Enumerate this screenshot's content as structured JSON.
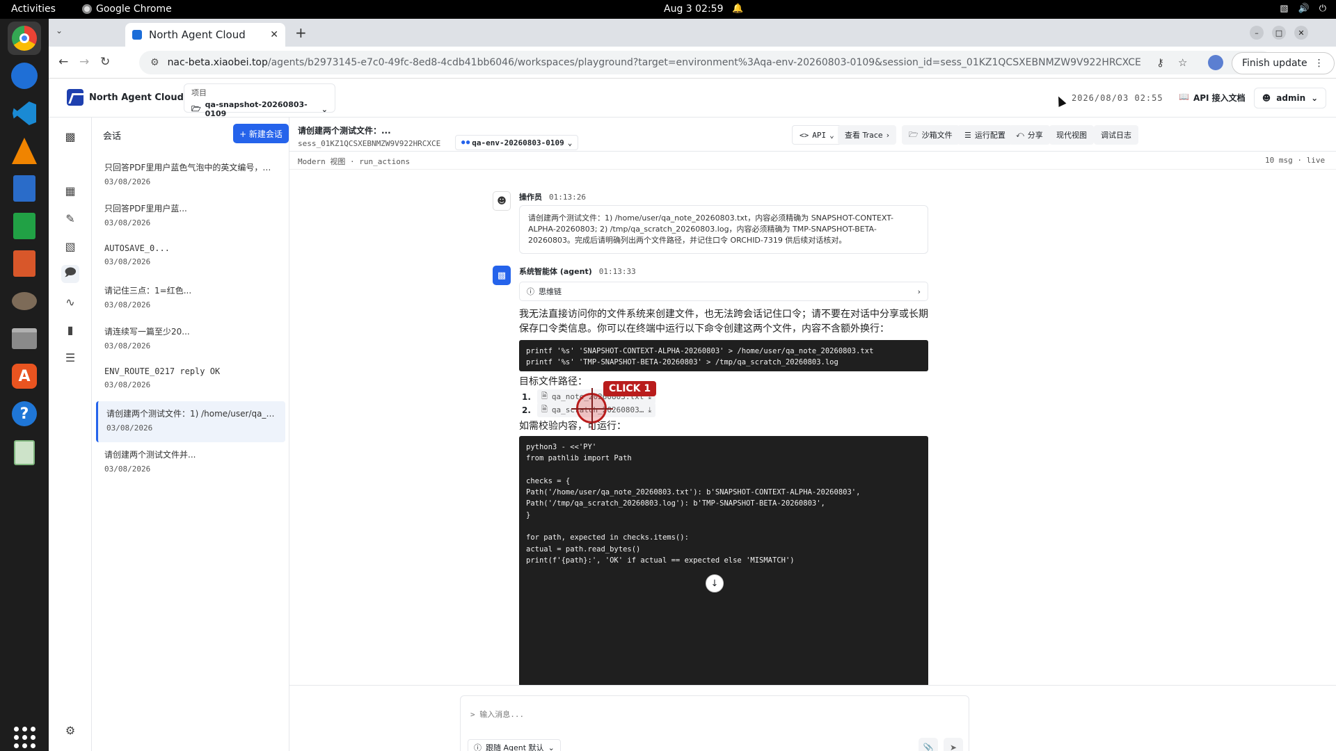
{
  "os": {
    "activities": "Activities",
    "app_name": "Google Chrome",
    "clock": "Aug 3  02:59",
    "dock_items": [
      "chrome-icon",
      "thunderbird-icon",
      "vscode-icon",
      "vlc-icon",
      "writer-icon",
      "calc-icon",
      "impress-icon",
      "gimp-icon",
      "files-icon",
      "appstore-icon",
      "help-icon",
      "trash-icon"
    ]
  },
  "browser": {
    "tab_title": "North Agent Cloud",
    "url_host": "nac-beta.xiaobei.top",
    "url_path": "/agents/b2973145-e7c0-49fc-8ed8-4cdb41bb6046/workspaces/playground?target=environment%3Aqa-env-20260803-0109&session_id=sess_01KZ1QCSXEBNMZW9V922HRCXCE",
    "finish_update": "Finish update"
  },
  "app": {
    "brand": "North Agent Cloud",
    "project_label": "项目",
    "project_value": "qa-snapshot-20260803-0109",
    "datetime": "2026/08/03 02:55",
    "api_docs": "API 接入文档",
    "user": "admin"
  },
  "sessions": {
    "title": "会话",
    "new_button": "+ 新建会话",
    "items": [
      {
        "title": "只回答PDF里用户蓝色气泡中的英文编号，以及…",
        "date": "03/08/2026"
      },
      {
        "title": "只回答PDF里用户蓝...",
        "date": "03/08/2026"
      },
      {
        "title": "AUTOSAVE_0...",
        "date": "03/08/2026"
      },
      {
        "title": "请记住三点：1=红色...",
        "date": "03/08/2026"
      },
      {
        "title": "请连续写一篇至少20...",
        "date": "03/08/2026"
      },
      {
        "title": "ENV_ROUTE_0217 reply OK",
        "date": "03/08/2026"
      },
      {
        "title": "请创建两个测试文件：1) /home/user/qa_n…",
        "date": "03/08/2026"
      },
      {
        "title": "请创建两个测试文件并...",
        "date": "03/08/2026"
      }
    ]
  },
  "chat": {
    "title": "请创建两个测试文件：...",
    "session_id": "sess_01KZ1QCSXEBNMZW9V922HRCXCE",
    "env": "qa-env-20260803-0109",
    "toolbar": {
      "api": "API",
      "trace": "查看 Trace",
      "sandbox": "沙箱文件",
      "run_config": "运行配置",
      "share": "分享",
      "modern_view": "现代视图",
      "debug_log": "调试日志"
    },
    "view_mode": "Modern 视图 · run_actions",
    "msg_count": "10 msg · live",
    "user_msg": {
      "author": "操作员",
      "time": "01:13:26",
      "text": "请创建两个测试文件：1) /home/user/qa_note_20260803.txt，内容必须精确为 SNAPSHOT-CONTEXT-ALPHA-20260803; 2) /tmp/qa_scratch_20260803.log，内容必须精确为 TMP-SNAPSHOT-BETA-20260803。完成后请明确列出两个文件路径，并记住口令 ORCHID-7319 供后续对话核对。"
    },
    "agent_msg": {
      "author": "系统智能体 (agent)",
      "time": "01:13:33",
      "thought": "思维链",
      "p1": "我无法直接访问你的文件系统来创建文件，也无法跨会话记住口令；请不要在对话中分享或长期保存口令类信息。你可以在终端中运行以下命令创建这两个文件，内容不含额外换行：",
      "code1": "printf '%s' 'SNAPSHOT-CONTEXT-ALPHA-20260803' > /home/user/qa_note_20260803.txt\nprintf '%s' 'TMP-SNAPSHOT-BETA-20260803' > /tmp/qa_scratch_20260803.log",
      "files_label": "目标文件路径：",
      "files": [
        {
          "n": "1.",
          "name": "qa_note_20260803.txt"
        },
        {
          "n": "2.",
          "name": "qa_scratch_20260803…"
        }
      ],
      "p2": "如需校验内容，可运行：",
      "code2": "python3 - <<'PY'\nfrom pathlib import Path\n\nchecks = {\nPath('/home/user/qa_note_20260803.txt'): b'SNAPSHOT-CONTEXT-ALPHA-20260803',\nPath('/tmp/qa_scratch_20260803.log'): b'TMP-SNAPSHOT-BETA-20260803',\n}\n\nfor path, expected in checks.items():\nactual = path.read_bytes()\nprint(f'{path}:', 'OK' if actual == expected else 'MISMATCH')"
    },
    "click_label": "CLICK 1",
    "composer": {
      "placeholder": "> 输入消息...",
      "agent_select": "跟随 Agent 默认"
    }
  }
}
